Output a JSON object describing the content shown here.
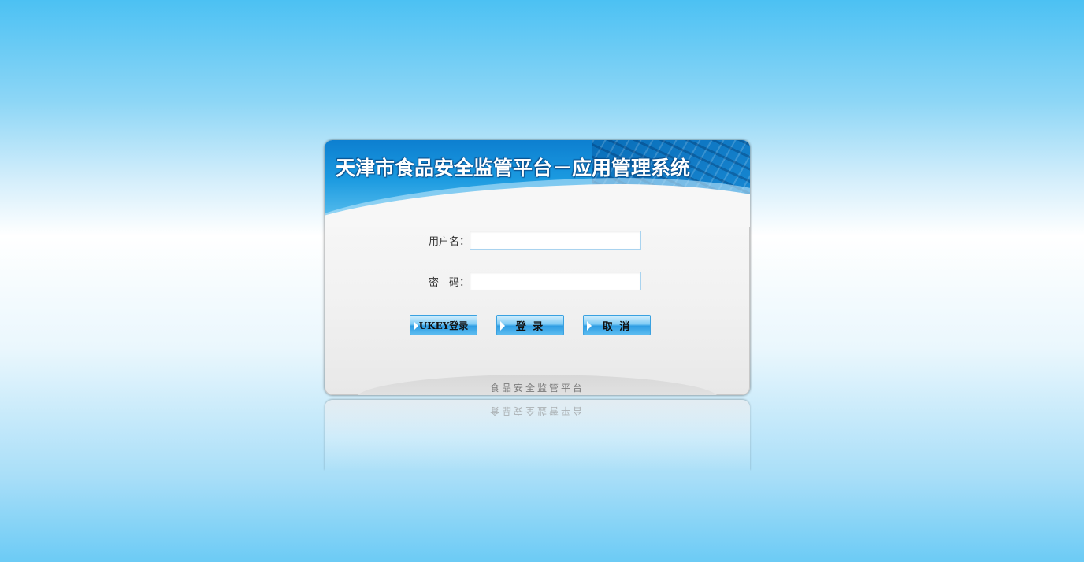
{
  "banner": {
    "title": "天津市食品安全监管平台－应用管理系统"
  },
  "form": {
    "username_label": "用户名：",
    "username_value": "",
    "password_label": "密　码：",
    "password_value": ""
  },
  "buttons": {
    "ukey_login": "UKEY登录",
    "login": "登 录",
    "cancel": "取 消"
  },
  "footer": {
    "text": "食品安全监管平台"
  }
}
